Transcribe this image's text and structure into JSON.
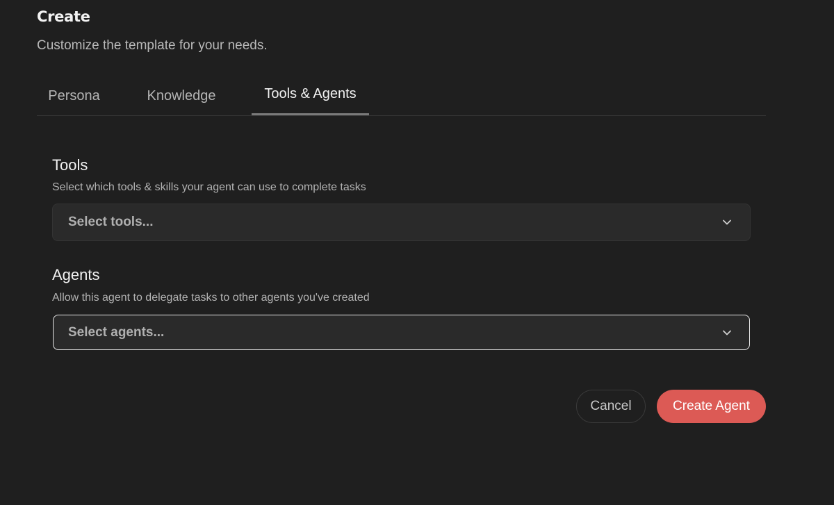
{
  "header": {
    "title": "Create",
    "subtitle": "Customize the template for your needs."
  },
  "tabs": [
    {
      "label": "Persona",
      "active": false
    },
    {
      "label": "Knowledge",
      "active": false
    },
    {
      "label": "Tools & Agents",
      "active": true
    }
  ],
  "tools": {
    "title": "Tools",
    "description": "Select which tools & skills your agent can use to complete tasks",
    "placeholder": "Select tools...",
    "icon": "chevron-down-icon"
  },
  "agents": {
    "title": "Agents",
    "description": "Allow this agent to delegate tasks to other agents you've created",
    "placeholder": "Select agents...",
    "icon": "chevron-down-icon"
  },
  "actions": {
    "cancel_label": "Cancel",
    "create_label": "Create Agent"
  },
  "colors": {
    "background": "#1f1f1f",
    "accent": "#dc5a55"
  }
}
